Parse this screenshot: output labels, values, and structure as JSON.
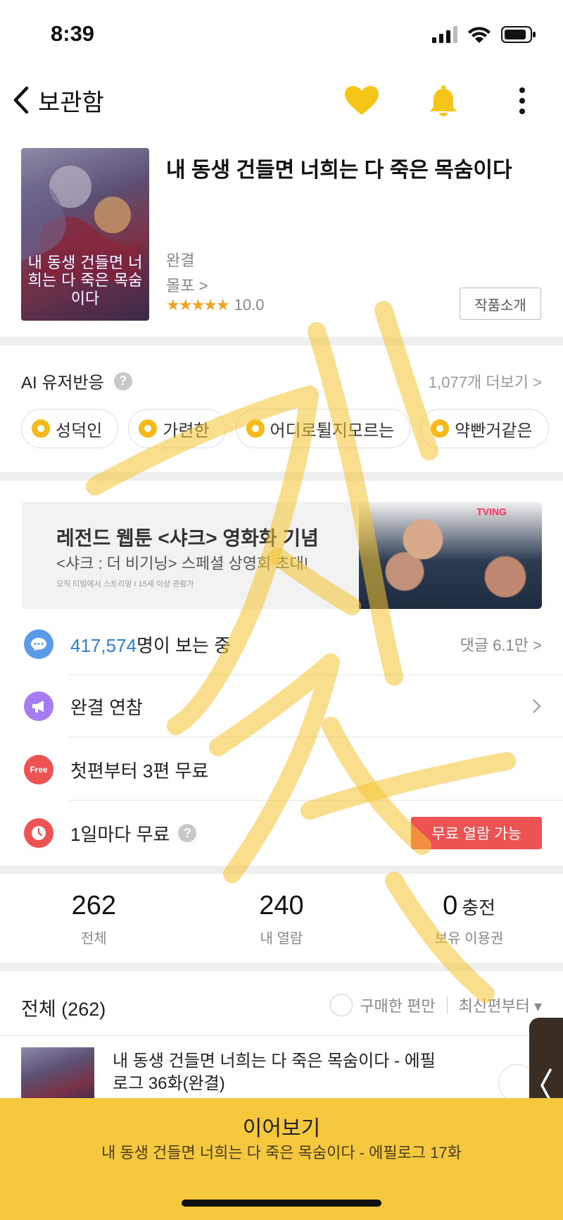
{
  "status_bar": {
    "time": "8:39"
  },
  "nav": {
    "back_label": "보관함"
  },
  "work": {
    "title": "내 동생 건들면 너희는 다 죽은 목숨이다",
    "cover_text": "내 동생 건들면 너희는 다 죽은 목숨이다",
    "status": "완결",
    "author": "몰포 >",
    "stars": "★★★★★",
    "rating": "10.0",
    "intro_button": "작품소개"
  },
  "ai": {
    "title": "AI 유저반응",
    "help": "?",
    "more": "1,077개 더보기 >",
    "chips": [
      "성덕인",
      "가련한",
      "어디로튈지모르는",
      "약빤거같은"
    ]
  },
  "banner": {
    "title": "레전드 웹툰 <샤크> 영화화 기념",
    "subtitle": "<샤크 : 더 비기닝> 스페셜 상영회 초대!",
    "note": "오직 티빙에서 스트리밍 I 15세 이상 관람가",
    "brand": "TVING"
  },
  "info": {
    "viewers_count": "417,574",
    "viewers_suffix": "명이 보는 중",
    "comments": "댓글 6.1만 >",
    "participation": "완결 연참",
    "free_icon": "Free",
    "free_first": "첫편부터 3편 무료",
    "daily_free": "1일마다 무료",
    "daily_help": "?",
    "daily_button": "무료 열람 가능"
  },
  "stats": [
    {
      "value": "262",
      "unit": "",
      "label": "전체"
    },
    {
      "value": "240",
      "unit": "",
      "label": "내 열람"
    },
    {
      "value": "0",
      "unit": "충전",
      "label": "보유 이용권"
    }
  ],
  "list": {
    "title": "전체 (262)",
    "purchased_filter": "구매한 편만",
    "sort": "최신편부터 ▾",
    "episode_title": "내 동생 건들면 너희는 다 죽은 목숨이다 - 에필로그 36화(완결)"
  },
  "continue": {
    "title": "이어보기",
    "subtitle": "내 동생 건들면 너희는 다 죽은 목숨이다 - 에필로그 17화"
  },
  "colors": {
    "accent_yellow": "#f6c83e",
    "heart_yellow": "#f5c518",
    "link_blue": "#2f7ed8",
    "free_red": "#ee5353",
    "star_orange": "#f3a321"
  },
  "icons": [
    "back-chevron-icon",
    "heart-icon",
    "bell-icon",
    "more-vertical-icon",
    "help-icon",
    "chat-bubble-icon",
    "megaphone-icon",
    "free-icon",
    "clock-icon",
    "download-icon",
    "signal-icon",
    "wifi-icon",
    "battery-icon"
  ]
}
